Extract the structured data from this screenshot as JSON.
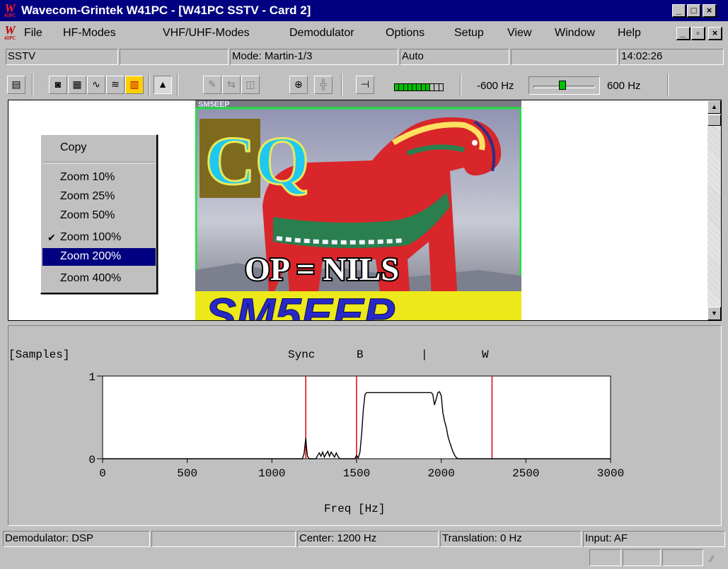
{
  "window": {
    "title": "Wavecom-Grintek W41PC - [W41PC SSTV  - Card 2]",
    "app_icon_text": "W",
    "app_icon_sub": "41PC",
    "buttons": [
      "_",
      "□",
      "×"
    ]
  },
  "menu": {
    "items": [
      "File",
      "HF-Modes",
      "VHF/UHF-Modes",
      "Demodulator",
      "Options",
      "Setup",
      "View",
      "Window",
      "Help"
    ],
    "mdi_buttons": [
      "_",
      "▫",
      "×"
    ]
  },
  "status_top": {
    "mode_name": "SSTV",
    "blank1": "",
    "mode": "Mode: Martin-1/3",
    "sync": "Auto",
    "blank2": "",
    "time": "14:02:26"
  },
  "toolbar": {
    "freq_low": "-600 Hz",
    "freq_high": "600 Hz",
    "level": 0.73,
    "tuning_offset_hz": 0
  },
  "picture": {
    "callsign_banner": "SM5EEP",
    "big_letters": "CQ",
    "overlay_text": "OP = NILS",
    "bottom_text": "SM5EEP"
  },
  "context_menu": {
    "items": [
      {
        "label": "Copy",
        "checked": false,
        "highlighted": false
      },
      {
        "label": "Zoom 10%",
        "checked": false,
        "highlighted": false
      },
      {
        "label": "Zoom 25%",
        "checked": false,
        "highlighted": false
      },
      {
        "label": "Zoom 50%",
        "checked": false,
        "highlighted": false
      },
      {
        "label": "Zoom 100%",
        "checked": true,
        "highlighted": false
      },
      {
        "label": "Zoom 200%",
        "checked": false,
        "highlighted": true
      },
      {
        "label": "Zoom 400%",
        "checked": false,
        "highlighted": false
      }
    ],
    "check_glyph": "✔"
  },
  "spectrum": {
    "samples_label": "[Samples]",
    "marker_sync": "Sync",
    "marker_b": "B",
    "marker_bar": "|",
    "marker_w": "W",
    "xlabel": "Freq [Hz]"
  },
  "chart_data": {
    "type": "line",
    "xlabel": "Freq [Hz]",
    "ylabel": "",
    "xlim": [
      0,
      3000
    ],
    "ylim": [
      0,
      1
    ],
    "xticks": [
      0,
      500,
      1000,
      1500,
      2000,
      2500,
      3000
    ],
    "yticks": [
      0,
      1
    ],
    "markers": [
      {
        "x": 1200,
        "color": "#e00000"
      },
      {
        "x": 1500,
        "color": "#e00000"
      },
      {
        "x": 2300,
        "color": "#e00000"
      }
    ],
    "series": [
      {
        "color": "#000000",
        "x": [
          0,
          1180,
          1190,
          1200,
          1205,
          1210,
          1220,
          1260,
          1270,
          1280,
          1290,
          1300,
          1310,
          1320,
          1330,
          1340,
          1350,
          1360,
          1370,
          1380,
          1390,
          1400,
          1490,
          1500,
          1510,
          1520,
          1530,
          1540,
          1550,
          1560,
          1600,
          1700,
          1800,
          1900,
          1940,
          1950,
          1960,
          1970,
          1980,
          1990,
          2000,
          2010,
          2020,
          2030,
          2040,
          2050,
          2060,
          2070,
          2080,
          2090,
          2100,
          2200,
          3000
        ],
        "y": [
          0,
          0,
          0.06,
          0.25,
          0.12,
          0.03,
          0,
          0,
          0.04,
          0.07,
          0.03,
          0.08,
          0.02,
          0.06,
          0.09,
          0.03,
          0.08,
          0.05,
          0.02,
          0.07,
          0.03,
          0,
          0,
          0.04,
          0.01,
          0.08,
          0.3,
          0.6,
          0.78,
          0.8,
          0.8,
          0.8,
          0.8,
          0.8,
          0.8,
          0.78,
          0.65,
          0.72,
          0.8,
          0.81,
          0.76,
          0.55,
          0.45,
          0.38,
          0.27,
          0.2,
          0.14,
          0.08,
          0.04,
          0.01,
          0,
          0,
          0
        ]
      }
    ]
  },
  "status_bottom": {
    "demodulator": "Demodulator: DSP",
    "blank": "",
    "center": "Center: 1200 Hz",
    "translation": "Translation: 0 Hz",
    "input": "Input: AF"
  }
}
